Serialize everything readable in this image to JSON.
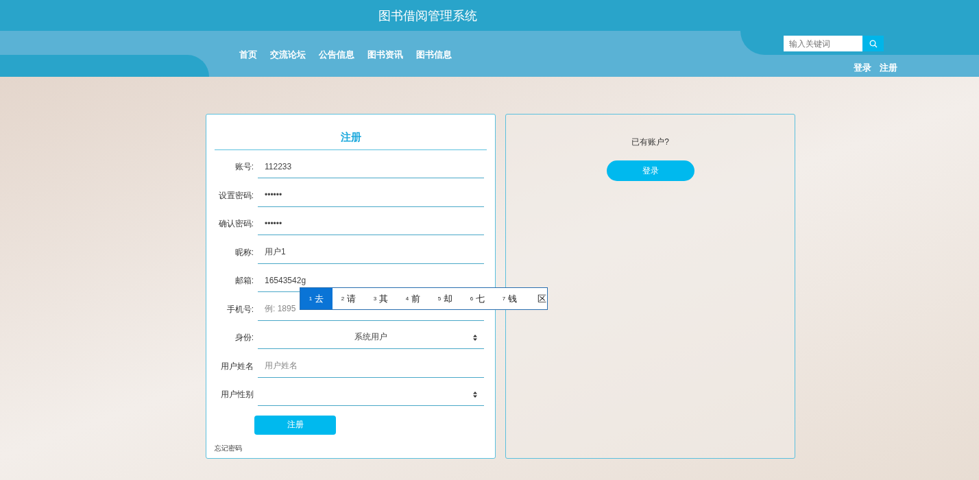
{
  "header": {
    "title": "图书借阅管理系统"
  },
  "nav": {
    "items": [
      {
        "label": "首页"
      },
      {
        "label": "交流论坛"
      },
      {
        "label": "公告信息"
      },
      {
        "label": "图书资讯"
      },
      {
        "label": "图书信息"
      }
    ]
  },
  "search": {
    "placeholder": "输入关键词"
  },
  "auth_links": [
    "登录",
    "注册"
  ],
  "register_form": {
    "title": "注册",
    "fields": [
      {
        "kind": "text",
        "label": "账号:",
        "value": "112233"
      },
      {
        "kind": "text",
        "label": "设置密码:",
        "value": "••••••"
      },
      {
        "kind": "text",
        "label": "确认密码:",
        "value": "••••••"
      },
      {
        "kind": "text",
        "label": "昵称:",
        "value": "用户1"
      },
      {
        "kind": "text",
        "label": "邮箱:",
        "value": "16543542g"
      },
      {
        "kind": "hint",
        "label": "手机号:",
        "placeholder": "例: 1895"
      },
      {
        "kind": "select",
        "label": "身份:",
        "value": "系统用户"
      },
      {
        "kind": "hint",
        "label": "用户姓名",
        "placeholder": "用户姓名"
      },
      {
        "kind": "select",
        "label": "用户性别"
      }
    ],
    "submit": "注册",
    "forgot": "忘记密码"
  },
  "login_panel": {
    "prompt": "已有账户?",
    "button": "登录"
  },
  "ime": {
    "candidates": [
      {
        "index": "1",
        "text": "去",
        "selected": true
      },
      {
        "index": "2",
        "text": "请",
        "selected": false
      },
      {
        "index": "3",
        "text": "其",
        "selected": false
      },
      {
        "index": "4",
        "text": "前",
        "selected": false
      },
      {
        "index": "5",
        "text": "却",
        "selected": false
      },
      {
        "index": "6",
        "text": "七",
        "selected": false
      },
      {
        "index": "7",
        "text": "钱",
        "selected": false
      },
      {
        "text": "区",
        "selected": false
      }
    ]
  }
}
